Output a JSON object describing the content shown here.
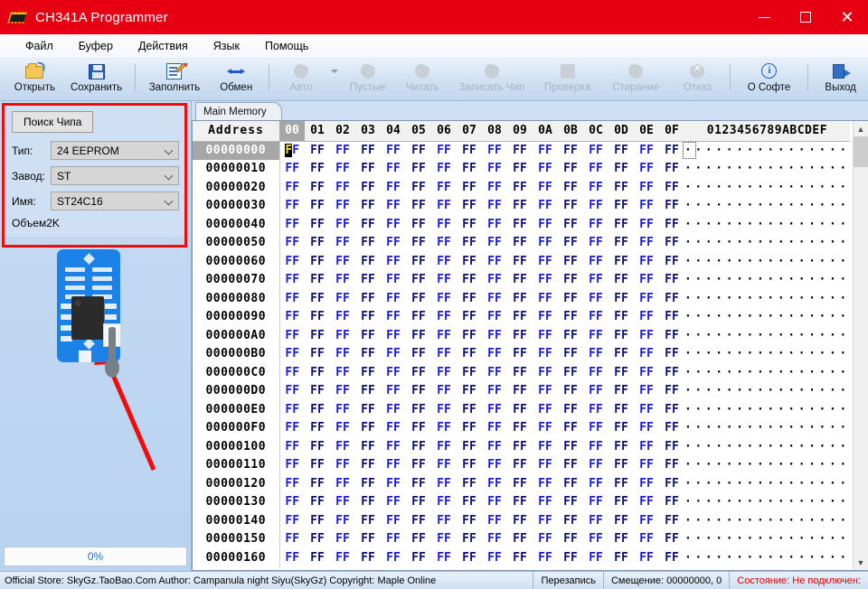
{
  "window": {
    "title": "CH341A Programmer",
    "icon": "chip-icon",
    "minimize": "—",
    "maximize": "□",
    "close": "✕"
  },
  "menubar": {
    "items": [
      {
        "label": "Файл",
        "name": "menu-file"
      },
      {
        "label": "Буфер",
        "name": "menu-buffer"
      },
      {
        "label": "Действия",
        "name": "menu-actions"
      },
      {
        "label": "Язык",
        "name": "menu-language"
      },
      {
        "label": "Помощь",
        "name": "menu-help"
      }
    ]
  },
  "toolbar": {
    "buttons": [
      {
        "label": "Открыть",
        "icon": "open-folder-icon",
        "enabled": true
      },
      {
        "label": "Сохранить",
        "icon": "save-floppy-icon",
        "enabled": true
      },
      {
        "label": "Заполнить",
        "icon": "fill-document-icon",
        "enabled": true
      },
      {
        "label": "Обмен",
        "icon": "swap-arrows-icon",
        "enabled": true
      },
      {
        "label": "Авто",
        "icon": "auto-icon",
        "enabled": false
      },
      {
        "label": "Пустые",
        "icon": "blank-check-icon",
        "enabled": false
      },
      {
        "label": "Читать",
        "icon": "read-icon",
        "enabled": false
      },
      {
        "label": "Записать Чип",
        "icon": "write-chip-icon",
        "enabled": false
      },
      {
        "label": "Проверка",
        "icon": "verify-icon",
        "enabled": false
      },
      {
        "label": "Стирание",
        "icon": "erase-icon",
        "enabled": false
      },
      {
        "label": "Отказ",
        "icon": "cancel-icon",
        "enabled": false
      },
      {
        "label": "О Софте",
        "icon": "info-icon",
        "enabled": true
      },
      {
        "label": "Выход",
        "icon": "exit-icon",
        "enabled": true
      }
    ]
  },
  "left_panel": {
    "search_button": "Поиск Чипа",
    "fields": [
      {
        "label": "Тип:",
        "value": "24 EEPROM",
        "name": "chip-type-combo"
      },
      {
        "label": "Завод:",
        "value": "ST",
        "name": "chip-vendor-combo"
      },
      {
        "label": "Имя:",
        "value": "ST24C16",
        "name": "chip-name-combo"
      }
    ],
    "volume": "Объем2K",
    "progress": "0%",
    "highlight_color": "#f30b0b"
  },
  "hex_view": {
    "tab": "Main Memory",
    "headers": {
      "address": "Address",
      "columns": [
        "00",
        "01",
        "02",
        "03",
        "04",
        "05",
        "06",
        "07",
        "08",
        "09",
        "0A",
        "0B",
        "0C",
        "0D",
        "0E",
        "0F"
      ],
      "ascii": "0123456789ABCDEF"
    },
    "selected_column": "00",
    "cursor_byte": "FF",
    "cursor_nibble": "F",
    "fill_byte": "FF",
    "ascii_char": "·",
    "rows": [
      "00000000",
      "00000010",
      "00000020",
      "00000030",
      "00000040",
      "00000050",
      "00000060",
      "00000070",
      "00000080",
      "00000090",
      "000000A0",
      "000000B0",
      "000000C0",
      "000000D0",
      "000000E0",
      "000000F0",
      "00000100",
      "00000110",
      "00000120",
      "00000130",
      "00000140",
      "00000150",
      "00000160"
    ],
    "selected_row": "00000000"
  },
  "statusbar": {
    "credit": "Official Store: SkyGz.TaoBao.Com Author: Campanula night Siyu(SkyGz) Copyright: Maple Online",
    "mode": "Перезапись",
    "offset": "Смещение: 00000000, 0",
    "status": "Состояние: Не подключен:"
  }
}
